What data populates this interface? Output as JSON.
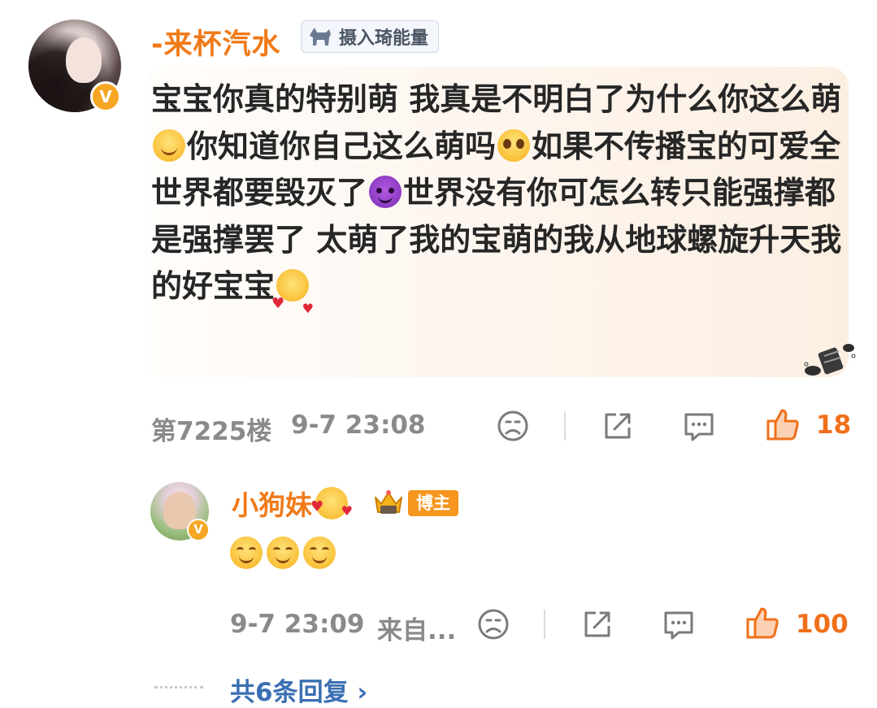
{
  "main_comment": {
    "username": "-来杯汽水",
    "badge_text": "摄入琦能量",
    "content_segments": [
      {
        "type": "text",
        "value": "宝宝你真的特别萌 我真是不明白了为什么你这么萌"
      },
      {
        "type": "emoji",
        "name": "smiling-face-emoji"
      },
      {
        "type": "text",
        "value": "你知道你自己这么萌吗"
      },
      {
        "type": "emoji",
        "name": "pleading-face-emoji"
      },
      {
        "type": "text",
        "value": "如果不传播宝的可爱全世界都要毁灭了"
      },
      {
        "type": "emoji",
        "name": "devil-face-emoji"
      },
      {
        "type": "text",
        "value": "世界没有你可怎么转只能强撑都是强撑罢了 太萌了我的宝萌的我从地球螺旋升天我的好宝宝"
      },
      {
        "type": "emoji",
        "name": "smiling-face-with-hearts-emoji"
      }
    ],
    "floor": "第7225楼",
    "time": "9-7 23:08",
    "like_count": "18"
  },
  "reply": {
    "username": "小狗妹",
    "role_tag": "博主",
    "content_emojis": [
      "smirk-emoji",
      "smirk-emoji",
      "smirk-emoji"
    ],
    "time": "9-7 23:09",
    "source": "来自...",
    "like_count": "100"
  },
  "more_replies": {
    "label": "共6条回复",
    "arrow": "›"
  },
  "icons": {
    "dislike": "frown-face-icon",
    "share": "share-icon",
    "comment": "comment-bubble-icon",
    "like": "thumbs-up-icon",
    "verified": "verified-v-icon"
  },
  "colors": {
    "username": "#f07a18",
    "like_active": "#f0701a",
    "link": "#3b6fb3",
    "blogger_tag": "#f6961e",
    "meta_text": "#8a8a8a"
  },
  "verified_mark": "V"
}
